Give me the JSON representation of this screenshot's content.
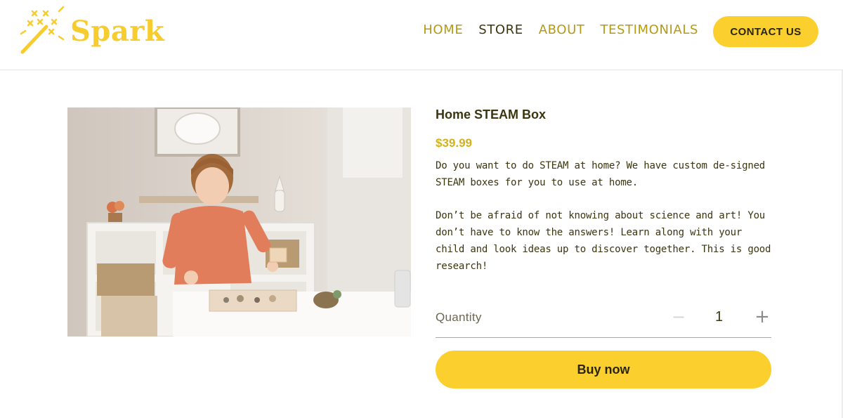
{
  "brand": {
    "name": "Spark",
    "logo_icon": "magic-wand-icon",
    "color": "#f7cc2f"
  },
  "nav": {
    "items": [
      {
        "label": "HOME",
        "active": false
      },
      {
        "label": "STORE",
        "active": true
      },
      {
        "label": "ABOUT",
        "active": false
      },
      {
        "label": "TESTIMONIALS",
        "active": false
      }
    ],
    "contact_label": "CONTACT US"
  },
  "product": {
    "title": "Home STEAM Box",
    "price": "$39.99",
    "description": [
      "Do you want to do STEAM at home? We have custom de-signed STEAM boxes for you to use at home.",
      "Don’t be afraid of not knowing about science and art! You don’t have to know the answers! Learn along with your child and look ideas up to discover together. This is good research!"
    ],
    "image": "child-playing-with-steam-box-photo"
  },
  "quantity": {
    "label": "Quantity",
    "value": "1",
    "minus_icon": "minus-icon",
    "plus_icon": "plus-icon"
  },
  "buy_label": "Buy now",
  "colors": {
    "accent": "#fbcf2e",
    "nav_text": "#b59a13",
    "price": "#d4b21a",
    "text_dark": "#3b3510"
  }
}
